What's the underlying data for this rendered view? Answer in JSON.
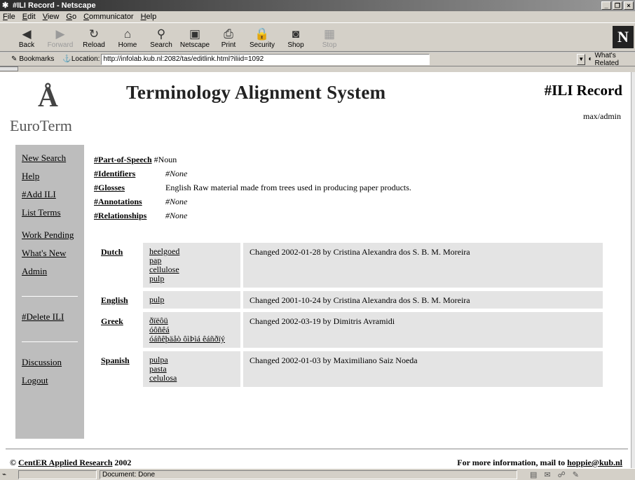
{
  "window": {
    "title": "#ILI Record - Netscape",
    "menu": [
      "File",
      "Edit",
      "View",
      "Go",
      "Communicator",
      "Help"
    ]
  },
  "toolbar": {
    "buttons": [
      {
        "label": "Back",
        "icon": "back-arrow-icon",
        "glyph": "◀"
      },
      {
        "label": "Forward",
        "icon": "forward-arrow-icon",
        "glyph": "▶"
      },
      {
        "label": "Reload",
        "icon": "reload-icon",
        "glyph": "↻"
      },
      {
        "label": "Home",
        "icon": "home-icon",
        "glyph": "⌂"
      },
      {
        "label": "Search",
        "icon": "search-icon",
        "glyph": "⚲"
      },
      {
        "label": "Netscape",
        "icon": "netscape-icon",
        "glyph": "▣"
      },
      {
        "label": "Print",
        "icon": "print-icon",
        "glyph": "⎙"
      },
      {
        "label": "Security",
        "icon": "security-icon",
        "glyph": "🔒"
      },
      {
        "label": "Shop",
        "icon": "shop-icon",
        "glyph": "◙"
      },
      {
        "label": "Stop",
        "icon": "stop-icon",
        "glyph": "▦"
      }
    ],
    "netscape_logo": "N"
  },
  "location": {
    "bookmarks_label": "Bookmarks",
    "location_label": "Location:",
    "url": "http://infolab.kub.nl:2082/tas/editlink.html?iliid=1092",
    "related_label": "What's Related"
  },
  "header": {
    "logo_text": "EuroTerm",
    "site_title": "Terminology Alignment System",
    "record_title": "#ILI Record",
    "user": "max/admin"
  },
  "sidebar": {
    "group1": [
      "New Search",
      "Help",
      "#Add ILI",
      "List Terms"
    ],
    "group2": [
      "Work Pending",
      "What's New",
      "Admin"
    ],
    "group3": [
      "#Delete ILI"
    ],
    "group4": [
      "Discussion",
      "Logout"
    ]
  },
  "properties": [
    {
      "key": "#Part-of-Speech",
      "value": "#Noun",
      "none": false
    },
    {
      "key": "#Identifiers",
      "value": "#None",
      "none": true
    },
    {
      "key": "#Glosses",
      "value": "English Raw material made from trees used in producing paper products.",
      "none": false
    },
    {
      "key": "#Annotations",
      "value": "#None",
      "none": true
    },
    {
      "key": "#Relationships",
      "value": "#None",
      "none": true
    }
  ],
  "languages": [
    {
      "name": "Dutch",
      "terms": [
        "heelgoed",
        "pap",
        "cellulose",
        "pulp"
      ],
      "changed": "Changed 2002-01-28 by Cristina Alexandra dos S. B. M. Moreira"
    },
    {
      "name": "English",
      "terms": [
        "pulp"
      ],
      "changed": "Changed 2001-10-24 by Cristina Alexandra dos S. B. M. Moreira"
    },
    {
      "name": "Greek",
      "terms": [
        "ðïëôü",
        "óôñêá",
        "óáñêþäåò ôìÞìá êáñðïý"
      ],
      "changed": "Changed 2002-03-19 by Dimitris Avramidi"
    },
    {
      "name": "Spanish",
      "terms": [
        "pulpa",
        "pasta",
        "celulosa"
      ],
      "changed": "Changed 2002-01-03 by Maximiliano Saiz Noeda"
    }
  ],
  "footer": {
    "copyright_prefix": "© ",
    "org": "CentER Applied Research",
    "year": " 2002",
    "info_prefix": "For more information, mail to ",
    "email": "hoppie@kub.nl"
  },
  "status": {
    "text": "Document: Done"
  }
}
